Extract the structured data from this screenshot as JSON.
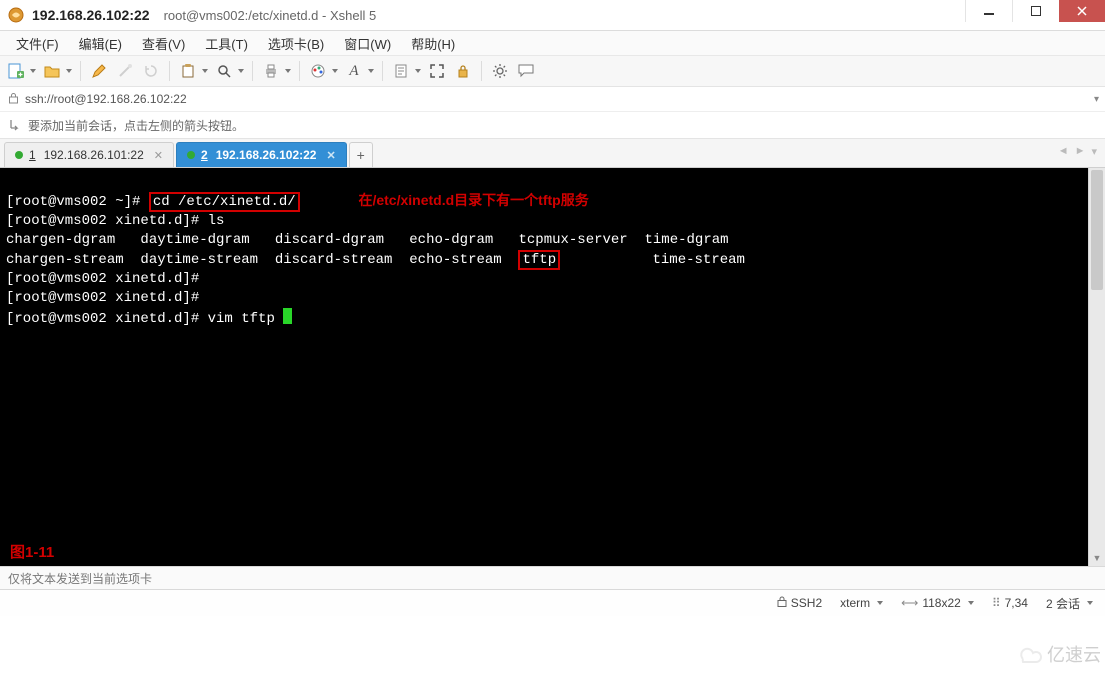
{
  "title": {
    "address": "192.168.26.102:22",
    "path": "root@vms002:/etc/xinetd.d - Xshell 5"
  },
  "menu": {
    "file": "文件(F)",
    "edit": "编辑(E)",
    "view": "查看(V)",
    "tools": "工具(T)",
    "tab": "选项卡(B)",
    "window": "窗口(W)",
    "help": "帮助(H)"
  },
  "addressbar": {
    "url": "ssh://root@192.168.26.102:22"
  },
  "hint": {
    "text": "要添加当前会话，点击左侧的箭头按钮。"
  },
  "tabs": {
    "t1_num": "1",
    "t1_label": "192.168.26.101:22",
    "t2_num": "2",
    "t2_label": "192.168.26.102:22",
    "add": "+"
  },
  "term": {
    "p1_prompt": "[root@vms002 ~]# ",
    "p1_cmd": "cd /etc/xinetd.d/",
    "p1_annot": "在/etc/xinetd.d目录下有一个tftp服务",
    "p2": "[root@vms002 xinetd.d]# ls",
    "l3a": "chargen-dgram   daytime-dgram   discard-dgram   echo-dgram   tcpmux-server  time-dgram",
    "l4_pre": "chargen-stream  daytime-stream  discard-stream  echo-stream  ",
    "l4_hl": "tftp",
    "l4_post": "           time-stream",
    "p5": "[root@vms002 xinetd.d]#",
    "p6": "[root@vms002 xinetd.d]#",
    "p7": "[root@vms002 xinetd.d]# vim tftp ",
    "figlabel": "图1-11"
  },
  "msg": {
    "text": "仅将文本发送到当前选项卡"
  },
  "status": {
    "proto": "SSH2",
    "term": "xterm",
    "size": "118x22",
    "pos": "7,34",
    "sess": "2 会话"
  },
  "watermark": {
    "text": "亿速云"
  },
  "icons": {
    "newdoc": "new-doc-icon",
    "openfolder": "open-folder-icon",
    "pencil": "pencil-icon",
    "wand": "wand-icon",
    "refresh": "refresh-icon",
    "clipboard": "clipboard-icon",
    "search": "search-icon",
    "printer": "printer-icon",
    "palette": "palette-icon",
    "font": "font-icon",
    "logbook": "logbook-icon",
    "fullscreen": "fullscreen-icon",
    "lock": "lock-icon",
    "gear": "gear-icon",
    "comment": "comment-icon"
  }
}
